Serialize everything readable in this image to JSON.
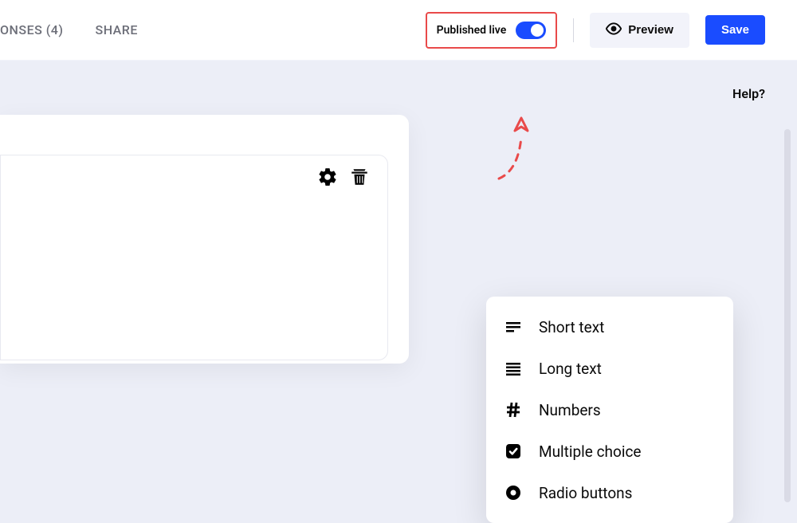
{
  "nav": {
    "responses": "ONSES (4)",
    "share": "SHARE"
  },
  "publish": {
    "label": "Published live",
    "enabled": true
  },
  "buttons": {
    "preview": "Preview",
    "save": "Save"
  },
  "help": "Help?",
  "fieldTypes": [
    {
      "icon": "short-text",
      "label": "Short text"
    },
    {
      "icon": "long-text",
      "label": "Long text"
    },
    {
      "icon": "hash",
      "label": "Numbers"
    },
    {
      "icon": "check-square",
      "label": "Multiple choice"
    },
    {
      "icon": "radio",
      "label": "Radio buttons"
    }
  ],
  "colors": {
    "primary": "#1a4cff",
    "highlight": "#e94a4a",
    "muted": "#6c6e78"
  }
}
